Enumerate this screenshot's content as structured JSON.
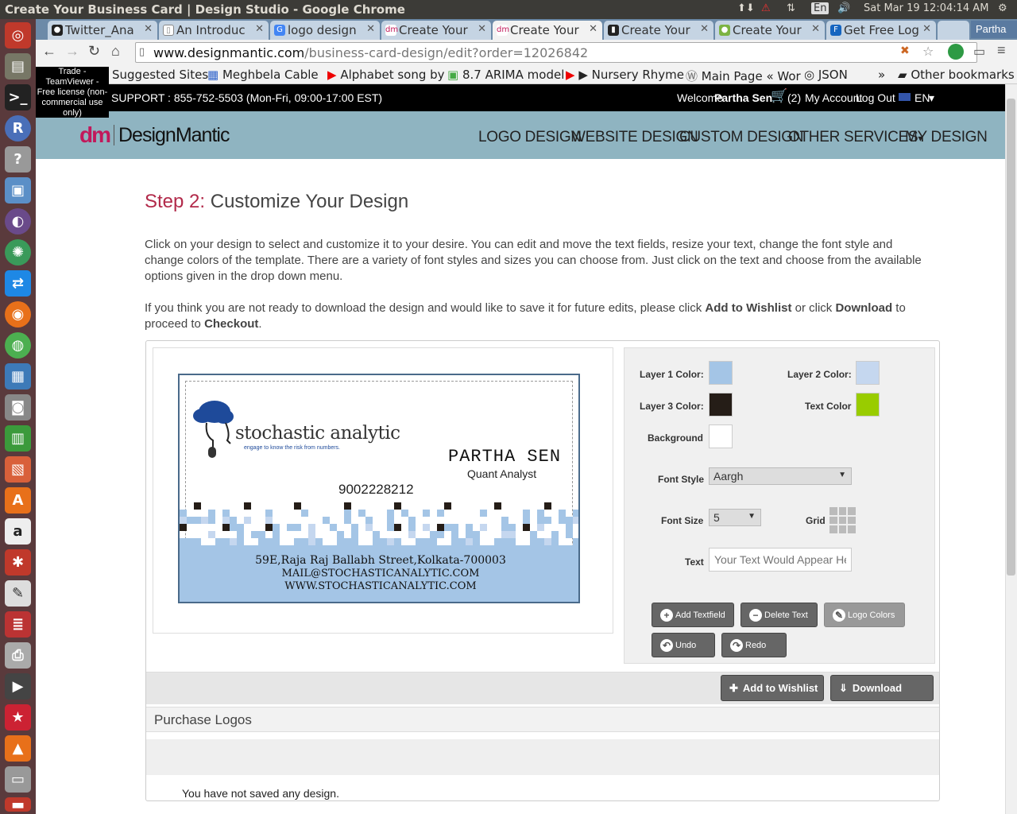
{
  "window": {
    "title": "Create Your Business Card | Design Studio - Google Chrome",
    "datetime": "Sat Mar 19 12:04:14 AM",
    "lang": "En"
  },
  "tabs": [
    {
      "label": "Twitter_Ana",
      "icon": "github-icon"
    },
    {
      "label": "An Introduc",
      "icon": "doc-icon"
    },
    {
      "label": "logo design",
      "icon": "google-icon"
    },
    {
      "label": "Create Your",
      "icon": "dm-icon"
    },
    {
      "label": "Create Your",
      "icon": "dm-icon"
    },
    {
      "label": "Create Your",
      "icon": "zip-icon"
    },
    {
      "label": "Create Your",
      "icon": "green-icon"
    },
    {
      "label": "Get Free Log",
      "icon": "fls-icon"
    }
  ],
  "profile_name": "Partha",
  "url": {
    "host": "www.designmantic.com",
    "path": "/business-card-design/edit?order=12026842"
  },
  "bookmarks": [
    "Suggested Sites",
    "Meghbela Cable",
    "Alphabet song by",
    "8.7 ARIMA model",
    "▶ Nursery Rhyme",
    "Main Page « Wor",
    "JSON"
  ],
  "bookmarks_more": "»",
  "other_bookmarks": "Other bookmarks",
  "teamviewer": "Trade - TeamViewer - Free license (non-commercial use only)",
  "support": {
    "text": "SUPPORT : 855-752-5503 (Mon-Fri, 09:00-17:00 EST)",
    "welcome": "Welcome",
    "user": "Partha Sen",
    "cart": "(2)",
    "account": "My Account",
    "logout": "Log Out",
    "lang": "EN"
  },
  "brand": {
    "logo_mark": "dm",
    "logo_text": "DesignMantic"
  },
  "nav": [
    "LOGO DESIGN",
    "WEBSITE DESIGN",
    "CUSTOM DESIGN",
    "OTHER SERVICES",
    "MY DESIGN"
  ],
  "step": {
    "prefix": "Step 2:",
    "title": "Customize Your Design"
  },
  "intro1": "Click on your design to select and customize it to your desire. You can edit and move the text fields, resize your text, change the font style and change colors of the template. There are a variety of font styles and sizes you can choose from. Just click on the text and choose from the available options given in the drop down menu.",
  "intro2": {
    "a": "If you think you are not ready to download the design and would like to save it for future edits, please click ",
    "b": "Add to Wishlist",
    "c": " or click ",
    "d": "Download",
    "e": " to proceed to ",
    "f": "Checkout",
    "g": "."
  },
  "card": {
    "company": "stochastic analytic",
    "tagline": "engage to know the risk from numbers.",
    "name": "PARTHA SEN",
    "role": "Quant Analyst",
    "phone": "9002228212",
    "address": "59E,Raja Raj Ballabh Street,Kolkata-700003",
    "email": "MAIL@STOCHASTICANALYTIC.COM",
    "web": "WWW.STOCHASTICANALYTIC.COM"
  },
  "controls": {
    "layer1": "Layer 1 Color:",
    "layer2": "Layer 2 Color:",
    "layer3": "Layer 3 Color:",
    "text_color": "Text Color",
    "background": "Background",
    "font_style": "Font Style",
    "font_style_value": "Aargh",
    "font_size": "Font Size",
    "font_size_value": "5",
    "grid": "Grid",
    "text": "Text",
    "text_placeholder": "Your Text Would Appear Here"
  },
  "colors": {
    "layer1": "#a4c5e6",
    "layer2": "#c5d7ef",
    "layer3": "#251d17",
    "text": "#99cc00",
    "background": "#ffffff"
  },
  "buttons": {
    "add_textfield": "Add Textfield",
    "delete_text": "Delete Text",
    "logo_colors": "Logo Colors",
    "undo": "Undo",
    "redo": "Redo",
    "wishlist": "Add to Wishlist",
    "download": "Download"
  },
  "purchase": {
    "title": "Purchase Logos",
    "empty": "You have not saved any design."
  }
}
